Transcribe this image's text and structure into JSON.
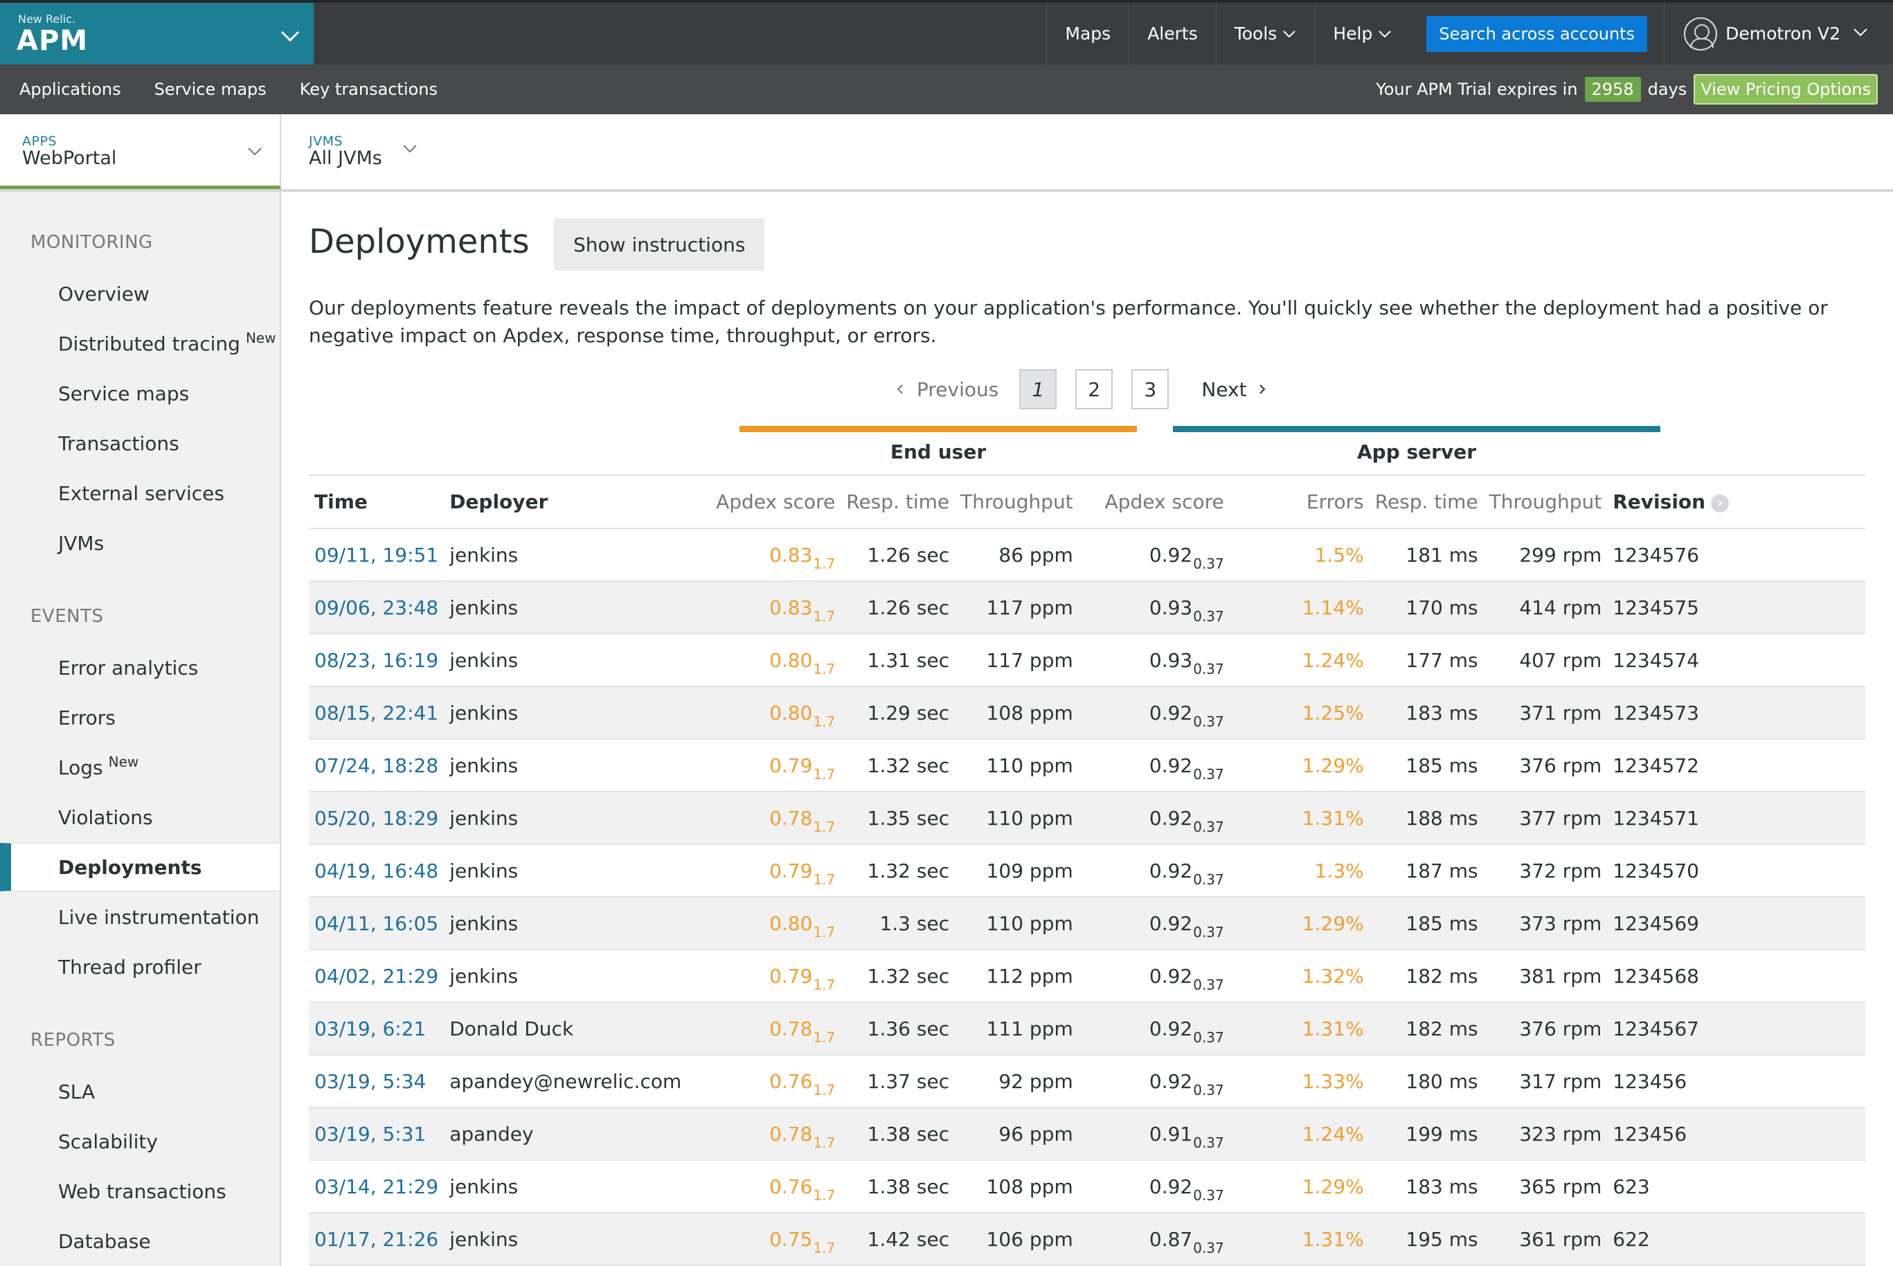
{
  "header": {
    "brand_small": "New Relic.",
    "brand": "APM",
    "nav": [
      "Maps",
      "Alerts",
      "Tools",
      "Help"
    ],
    "search_label": "Search across accounts",
    "user_name": "Demotron V2"
  },
  "subheader": {
    "nav": [
      "Applications",
      "Service maps",
      "Key transactions"
    ],
    "trial_prefix": "Your APM Trial expires in",
    "trial_days": "2958",
    "trial_suffix": "days",
    "pricing_label": "View Pricing Options"
  },
  "context": {
    "apps_label": "APPS",
    "apps_value": "WebPortal",
    "jvms_label": "JVMS",
    "jvms_value": "All JVMs"
  },
  "sidebar": {
    "monitoring_title": "MONITORING",
    "monitoring": [
      "Overview",
      "Distributed tracing",
      "Service maps",
      "Transactions",
      "External services",
      "JVMs"
    ],
    "new_badge": "New",
    "events_title": "EVENTS",
    "events": [
      "Error analytics",
      "Errors",
      "Logs",
      "Violations",
      "Deployments",
      "Live instrumentation",
      "Thread profiler"
    ],
    "reports_title": "REPORTS",
    "reports": [
      "SLA",
      "Scalability",
      "Web transactions",
      "Database"
    ]
  },
  "main": {
    "title": "Deployments",
    "instructions_label": "Show instructions",
    "intro": "Our deployments feature reveals the impact of deployments on your application's performance. You'll quickly see whether the deployment had a positive or negative impact on Apdex, response time, throughput, or errors.",
    "pager": {
      "previous": "Previous",
      "pages": [
        "1",
        "2",
        "3"
      ],
      "next": "Next"
    },
    "group_end_user": "End user",
    "group_app_server": "App server",
    "columns": {
      "time": "Time",
      "deployer": "Deployer",
      "eu_apdex": "Apdex score",
      "eu_resp": "Resp. time",
      "eu_throughput": "Throughput",
      "as_apdex": "Apdex score",
      "as_errors": "Errors",
      "as_resp": "Resp. time",
      "as_throughput": "Throughput",
      "revision": "Revision"
    },
    "rows": [
      {
        "time": "09/11, 19:51",
        "deployer": "jenkins",
        "eu_apdex": "0.83",
        "eu_apdex_t": "1.7",
        "eu_resp": "1.26 sec",
        "eu_throughput": "86 ppm",
        "as_apdex": "0.92",
        "as_apdex_t": "0.37",
        "as_errors": "1.5%",
        "as_resp": "181 ms",
        "as_throughput": "299 rpm",
        "revision": "1234576"
      },
      {
        "time": "09/06, 23:48",
        "deployer": "jenkins",
        "eu_apdex": "0.83",
        "eu_apdex_t": "1.7",
        "eu_resp": "1.26 sec",
        "eu_throughput": "117 ppm",
        "as_apdex": "0.93",
        "as_apdex_t": "0.37",
        "as_errors": "1.14%",
        "as_resp": "170 ms",
        "as_throughput": "414 rpm",
        "revision": "1234575"
      },
      {
        "time": "08/23, 16:19",
        "deployer": "jenkins",
        "eu_apdex": "0.80",
        "eu_apdex_t": "1.7",
        "eu_resp": "1.31 sec",
        "eu_throughput": "117 ppm",
        "as_apdex": "0.93",
        "as_apdex_t": "0.37",
        "as_errors": "1.24%",
        "as_resp": "177 ms",
        "as_throughput": "407 rpm",
        "revision": "1234574"
      },
      {
        "time": "08/15, 22:41",
        "deployer": "jenkins",
        "eu_apdex": "0.80",
        "eu_apdex_t": "1.7",
        "eu_resp": "1.29 sec",
        "eu_throughput": "108 ppm",
        "as_apdex": "0.92",
        "as_apdex_t": "0.37",
        "as_errors": "1.25%",
        "as_resp": "183 ms",
        "as_throughput": "371 rpm",
        "revision": "1234573"
      },
      {
        "time": "07/24, 18:28",
        "deployer": "jenkins",
        "eu_apdex": "0.79",
        "eu_apdex_t": "1.7",
        "eu_resp": "1.32 sec",
        "eu_throughput": "110 ppm",
        "as_apdex": "0.92",
        "as_apdex_t": "0.37",
        "as_errors": "1.29%",
        "as_resp": "185 ms",
        "as_throughput": "376 rpm",
        "revision": "1234572"
      },
      {
        "time": "05/20, 18:29",
        "deployer": "jenkins",
        "eu_apdex": "0.78",
        "eu_apdex_t": "1.7",
        "eu_resp": "1.35 sec",
        "eu_throughput": "110 ppm",
        "as_apdex": "0.92",
        "as_apdex_t": "0.37",
        "as_errors": "1.31%",
        "as_resp": "188 ms",
        "as_throughput": "377 rpm",
        "revision": "1234571"
      },
      {
        "time": "04/19, 16:48",
        "deployer": "jenkins",
        "eu_apdex": "0.79",
        "eu_apdex_t": "1.7",
        "eu_resp": "1.32 sec",
        "eu_throughput": "109 ppm",
        "as_apdex": "0.92",
        "as_apdex_t": "0.37",
        "as_errors": "1.3%",
        "as_resp": "187 ms",
        "as_throughput": "372 rpm",
        "revision": "1234570"
      },
      {
        "time": "04/11, 16:05",
        "deployer": "jenkins",
        "eu_apdex": "0.80",
        "eu_apdex_t": "1.7",
        "eu_resp": "1.3 sec",
        "eu_throughput": "110 ppm",
        "as_apdex": "0.92",
        "as_apdex_t": "0.37",
        "as_errors": "1.29%",
        "as_resp": "185 ms",
        "as_throughput": "373 rpm",
        "revision": "1234569"
      },
      {
        "time": "04/02, 21:29",
        "deployer": "jenkins",
        "eu_apdex": "0.79",
        "eu_apdex_t": "1.7",
        "eu_resp": "1.32 sec",
        "eu_throughput": "112 ppm",
        "as_apdex": "0.92",
        "as_apdex_t": "0.37",
        "as_errors": "1.32%",
        "as_resp": "182 ms",
        "as_throughput": "381 rpm",
        "revision": "1234568"
      },
      {
        "time": "03/19, 6:21",
        "deployer": "Donald Duck",
        "eu_apdex": "0.78",
        "eu_apdex_t": "1.7",
        "eu_resp": "1.36 sec",
        "eu_throughput": "111 ppm",
        "as_apdex": "0.92",
        "as_apdex_t": "0.37",
        "as_errors": "1.31%",
        "as_resp": "182 ms",
        "as_throughput": "376 rpm",
        "revision": "1234567"
      },
      {
        "time": "03/19, 5:34",
        "deployer": "apandey@newrelic.com",
        "eu_apdex": "0.76",
        "eu_apdex_t": "1.7",
        "eu_resp": "1.37 sec",
        "eu_throughput": "92 ppm",
        "as_apdex": "0.92",
        "as_apdex_t": "0.37",
        "as_errors": "1.33%",
        "as_resp": "180 ms",
        "as_throughput": "317 rpm",
        "revision": "123456"
      },
      {
        "time": "03/19, 5:31",
        "deployer": "apandey",
        "eu_apdex": "0.78",
        "eu_apdex_t": "1.7",
        "eu_resp": "1.38 sec",
        "eu_throughput": "96 ppm",
        "as_apdex": "0.91",
        "as_apdex_t": "0.37",
        "as_errors": "1.24%",
        "as_resp": "199 ms",
        "as_throughput": "323 rpm",
        "revision": "123456"
      },
      {
        "time": "03/14, 21:29",
        "deployer": "jenkins",
        "eu_apdex": "0.76",
        "eu_apdex_t": "1.7",
        "eu_resp": "1.38 sec",
        "eu_throughput": "108 ppm",
        "as_apdex": "0.92",
        "as_apdex_t": "0.37",
        "as_errors": "1.29%",
        "as_resp": "183 ms",
        "as_throughput": "365 rpm",
        "revision": "623"
      },
      {
        "time": "01/17, 21:26",
        "deployer": "jenkins",
        "eu_apdex": "0.75",
        "eu_apdex_t": "1.7",
        "eu_resp": "1.42 sec",
        "eu_throughput": "106 ppm",
        "as_apdex": "0.87",
        "as_apdex_t": "0.37",
        "as_errors": "1.31%",
        "as_resp": "195 ms",
        "as_throughput": "361 rpm",
        "revision": "622"
      }
    ]
  },
  "colors": {
    "brand_teal": "#1d7f93",
    "end_user_orange": "#f0961e",
    "link_blue": "#1d6f9e",
    "trial_green": "#6fa54b",
    "search_blue": "#0a7ad6"
  }
}
